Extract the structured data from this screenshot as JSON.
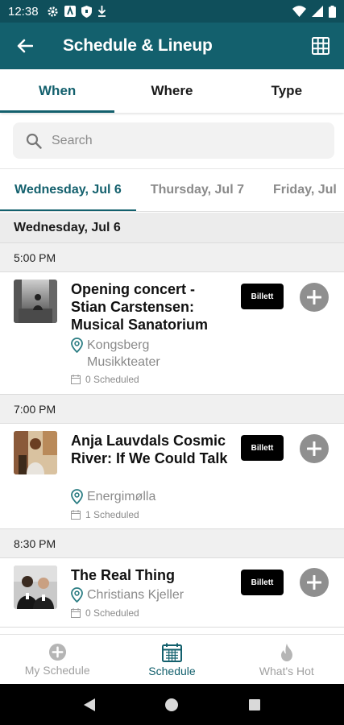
{
  "status_bar": {
    "time": "12:38"
  },
  "app_bar": {
    "title": "Schedule & Lineup"
  },
  "tabs": [
    {
      "label": "When",
      "active": true
    },
    {
      "label": "Where",
      "active": false
    },
    {
      "label": "Type",
      "active": false
    }
  ],
  "search": {
    "placeholder": "Search"
  },
  "date_tabs": [
    {
      "label": "Wednesday, Jul 6",
      "active": true
    },
    {
      "label": "Thursday, Jul 7",
      "active": false
    },
    {
      "label": "Friday, Jul",
      "active": false
    }
  ],
  "day_header": "Wednesday, Jul 6",
  "time_slots": [
    {
      "time": "5:00 PM",
      "event": {
        "title": "Opening concert - Stian Carstensen: Musical Sanatorium",
        "venue": "Kongsberg Musikkteater",
        "scheduled": "0 Scheduled",
        "ticket_label": "Billett"
      }
    },
    {
      "time": "7:00 PM",
      "event": {
        "title": "Anja Lauvdals Cosmic River: If We Could Talk",
        "venue": "Energimølla",
        "scheduled": "1 Scheduled",
        "ticket_label": "Billett"
      }
    },
    {
      "time": "8:30 PM",
      "event": {
        "title": "The Real Thing",
        "venue": "Christians Kjeller",
        "scheduled": "0 Scheduled",
        "ticket_label": "Billett"
      }
    }
  ],
  "bottom_nav": [
    {
      "label": "My Schedule",
      "icon": "plus-circle-icon",
      "active": false
    },
    {
      "label": "Schedule",
      "icon": "calendar-icon",
      "active": true
    },
    {
      "label": "What's Hot",
      "icon": "flame-icon",
      "active": false
    }
  ],
  "colors": {
    "primary": "#13606d",
    "status_bar": "#0f4f5b",
    "button_gray": "#8f8f8f"
  }
}
